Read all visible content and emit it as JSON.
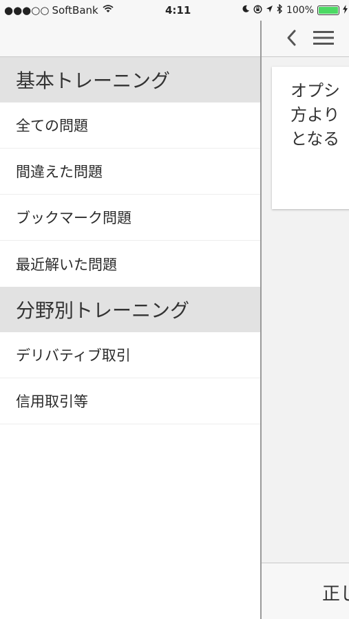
{
  "status_bar": {
    "carrier": "SoftBank",
    "signal_dots": "●●●○○",
    "time": "4:11",
    "battery_percent": "100%",
    "battery_level": 1.0,
    "battery_color": "#4cd964"
  },
  "drawer": {
    "sections": [
      {
        "title": "基本トレーニング",
        "items": [
          "全ての問題",
          "間違えた問題",
          "ブックマーク問題",
          "最近解いた問題"
        ]
      },
      {
        "title": "分野別トレーニング",
        "items": [
          "デリバティブ取引",
          "信用取引等"
        ]
      }
    ]
  },
  "main": {
    "question_preview": "オプシ\n方より\nとなる",
    "footer_label": "正し"
  },
  "icons": {
    "back": "chevron-left-icon",
    "menu": "hamburger-menu-icon",
    "wifi": "wifi-icon",
    "moon": "moon-icon",
    "orientation_lock": "orientation-lock-icon",
    "location": "location-arrow-icon",
    "bluetooth": "bluetooth-icon",
    "charging": "charging-bolt-icon"
  }
}
